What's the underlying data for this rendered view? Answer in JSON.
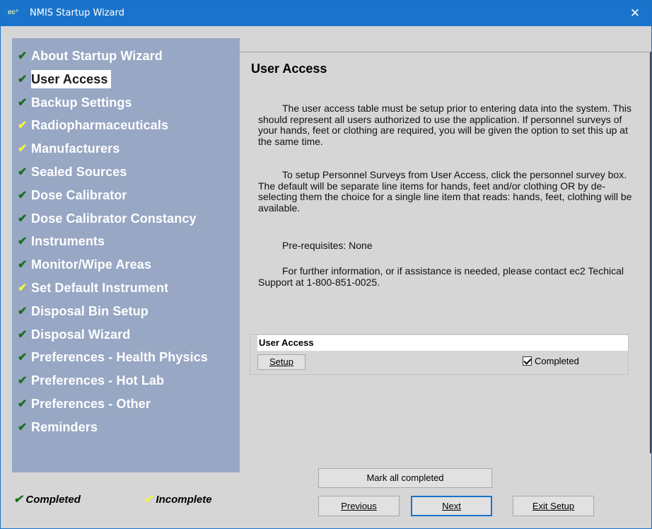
{
  "window": {
    "title": "NMIS Startup Wizard",
    "app_icon_text": "ec²",
    "close_glyph": "✕"
  },
  "sidebar": {
    "items": [
      {
        "label": "About Startup Wizard",
        "status": "completed"
      },
      {
        "label": "User Access",
        "status": "completed",
        "selected": true
      },
      {
        "label": "Backup Settings",
        "status": "completed"
      },
      {
        "label": "Radiopharmaceuticals",
        "status": "incomplete"
      },
      {
        "label": "Manufacturers",
        "status": "incomplete"
      },
      {
        "label": "Sealed Sources",
        "status": "completed"
      },
      {
        "label": "Dose Calibrator",
        "status": "completed"
      },
      {
        "label": "Dose Calibrator Constancy",
        "status": "completed"
      },
      {
        "label": "Instruments",
        "status": "completed"
      },
      {
        "label": "Monitor/Wipe Areas",
        "status": "completed"
      },
      {
        "label": "Set Default Instrument",
        "status": "incomplete"
      },
      {
        "label": "Disposal Bin Setup",
        "status": "completed"
      },
      {
        "label": "Disposal Wizard",
        "status": "completed"
      },
      {
        "label": "Preferences - Health Physics",
        "status": "completed"
      },
      {
        "label": "Preferences - Hot Lab",
        "status": "completed"
      },
      {
        "label": "Preferences - Other",
        "status": "completed"
      },
      {
        "label": "Reminders",
        "status": "completed"
      }
    ],
    "check_glyph": "✔"
  },
  "content": {
    "title": "User Access",
    "paragraphs": [
      "The user access table must be setup prior to entering data into the system.  This should represent all users authorized to use the application.  If personnel surveys of your hands, feet or clothing are required, you will be given the option to set this up at the same time.",
      "To setup Personnel Surveys from User Access, click the personnel survey box.  The default will be separate line items for hands, feet and/or clothing OR by de-selecting them the choice for a single line item that reads: hands, feet, clothing will be available.",
      "Pre-requisites: None",
      "For further information, or if assistance is needed, please contact ec2 Techical Support at 1-800-851-0025."
    ],
    "task": {
      "header": "User Access",
      "setup_label": "Setup",
      "completed_label": "Completed",
      "completed_checked": true
    }
  },
  "buttons": {
    "mark_all": "Mark all completed",
    "previous": "Previous",
    "next": "Next",
    "exit": "Exit Setup"
  },
  "legend": {
    "completed": "Completed",
    "incomplete": "Incomplete"
  },
  "colors": {
    "titlebar": "#1b74cb",
    "sidebar": "#97a7c4",
    "check_completed": "#1a6e1a",
    "check_incomplete": "#f4f442"
  }
}
